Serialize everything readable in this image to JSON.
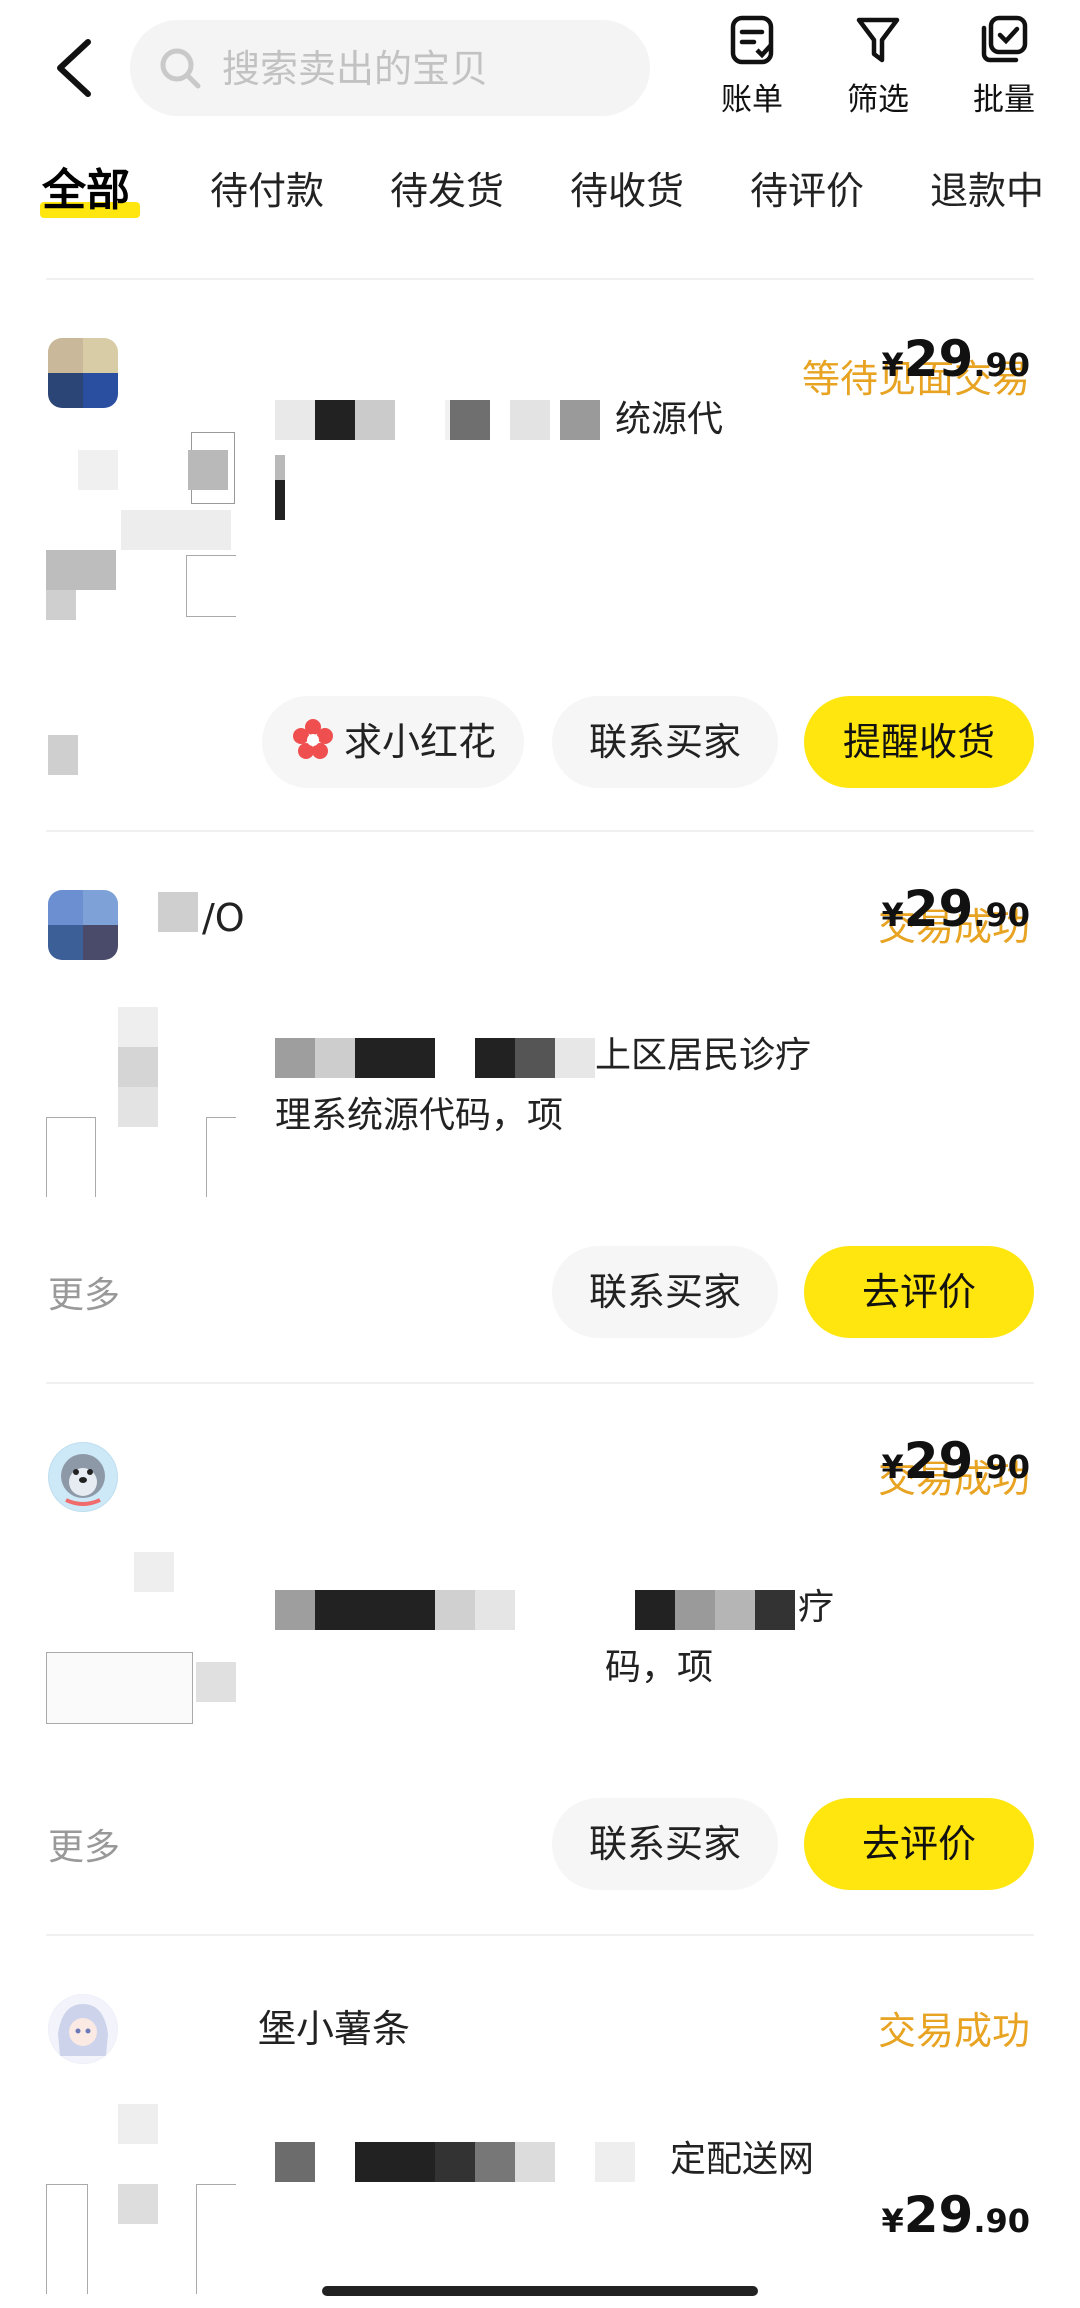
{
  "search": {
    "placeholder": "搜索卖出的宝贝"
  },
  "toolbar": {
    "bill_label": "账单",
    "filter_label": "筛选",
    "batch_label": "批量"
  },
  "tabs": [
    {
      "label": "全部",
      "active": true
    },
    {
      "label": "待付款"
    },
    {
      "label": "待发货"
    },
    {
      "label": "待收货"
    },
    {
      "label": "待评价"
    },
    {
      "label": "退款中"
    }
  ],
  "orders": [
    {
      "status": "等待见面交易",
      "buyer": "",
      "title_line1": "统源代",
      "title_line2": "",
      "price": {
        "currency": "¥",
        "int": "29",
        "dec": ".90"
      },
      "more_label": "",
      "buttons": [
        "求小红花",
        "联系买家",
        "提醒收货"
      ]
    },
    {
      "status": "交易成功",
      "buyer": "/O",
      "title_line1": "上区居民诊疗",
      "title_line2": "理系统源代码，项",
      "price": {
        "currency": "¥",
        "int": "29",
        "dec": ".90"
      },
      "more_label": "更多",
      "buttons": [
        "联系买家",
        "去评价"
      ]
    },
    {
      "status": "交易成功",
      "buyer": "",
      "title_line1": "疗",
      "title_line2": "码，项",
      "price": {
        "currency": "¥",
        "int": "29",
        "dec": ".90"
      },
      "more_label": "更多",
      "buttons": [
        "联系买家",
        "去评价"
      ]
    },
    {
      "status": "交易成功",
      "buyer": "堡小薯条",
      "title_line1": "定配送网",
      "title_line2": "",
      "price": {
        "currency": "¥",
        "int": "29",
        "dec": ".90"
      }
    }
  ],
  "colors": {
    "accent_yellow": "#ffe60f",
    "status_orange": "#e7a321",
    "flower_red": "#ef4f4f"
  }
}
